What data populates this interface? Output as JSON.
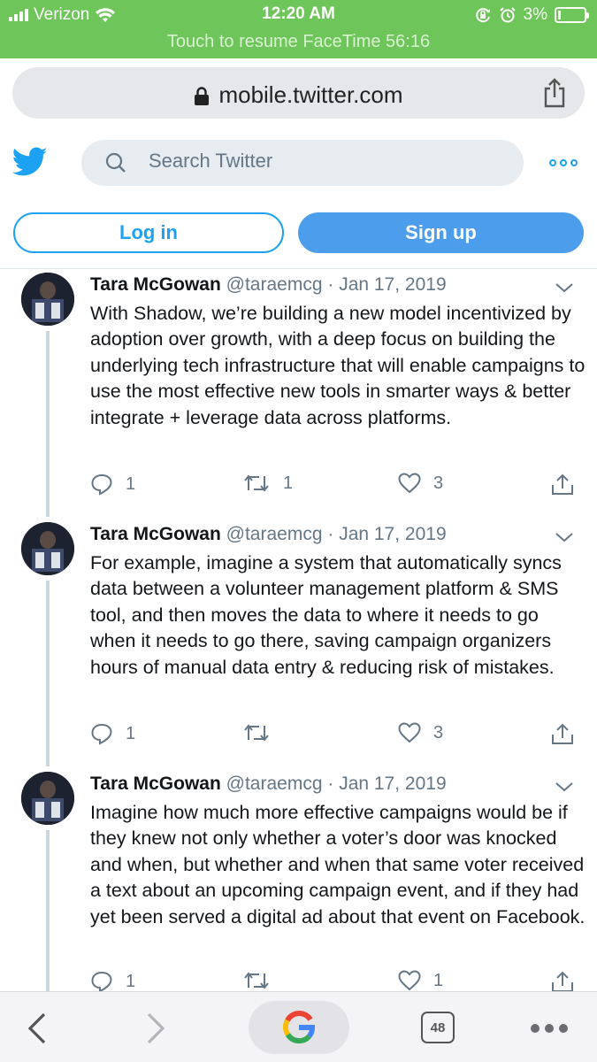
{
  "status_bar": {
    "carrier": "Verizon",
    "time": "12:20 AM",
    "battery": "3%",
    "banner": "Touch to resume FaceTime 56:16"
  },
  "browser": {
    "url": "mobile.twitter.com",
    "tab_count": "48"
  },
  "header": {
    "search_placeholder": "Search Twitter",
    "login_label": "Log in",
    "signup_label": "Sign up"
  },
  "colors": {
    "accent": "#1da1f2",
    "status_bar": "#6ec55a",
    "signup": "#4d9ded"
  },
  "tweets": [
    {
      "name": "Tara McGowan",
      "handle": "@taraemcg",
      "date": "Jan 17, 2019",
      "text": "With Shadow, we’re building a new model incentivized by adoption over growth, with a deep focus on building the underlying tech infrastructure that will enable campaigns to use the most effective new tools in smarter ways & better integrate + leverage data across platforms.",
      "replies": "1",
      "retweets": "1",
      "likes": "3"
    },
    {
      "name": "Tara McGowan",
      "handle": "@taraemcg",
      "date": "Jan 17, 2019",
      "text": "For example, imagine a system that automatically syncs data between a volunteer management platform & SMS tool, and then moves the data to where it needs to go when it needs to go there, saving campaign organizers hours of manual data entry & reducing risk of mistakes.",
      "replies": "1",
      "retweets": "",
      "likes": "3"
    },
    {
      "name": "Tara McGowan",
      "handle": "@taraemcg",
      "date": "Jan 17, 2019",
      "text": "Imagine how much more effective campaigns would be if they knew not only whether a voter’s door was knocked and when, but whether and when that same voter received a text about an upcoming campaign event, and if they had yet been served a digital ad about that event on Facebook.",
      "replies": "1",
      "retweets": "",
      "likes": "1"
    }
  ]
}
